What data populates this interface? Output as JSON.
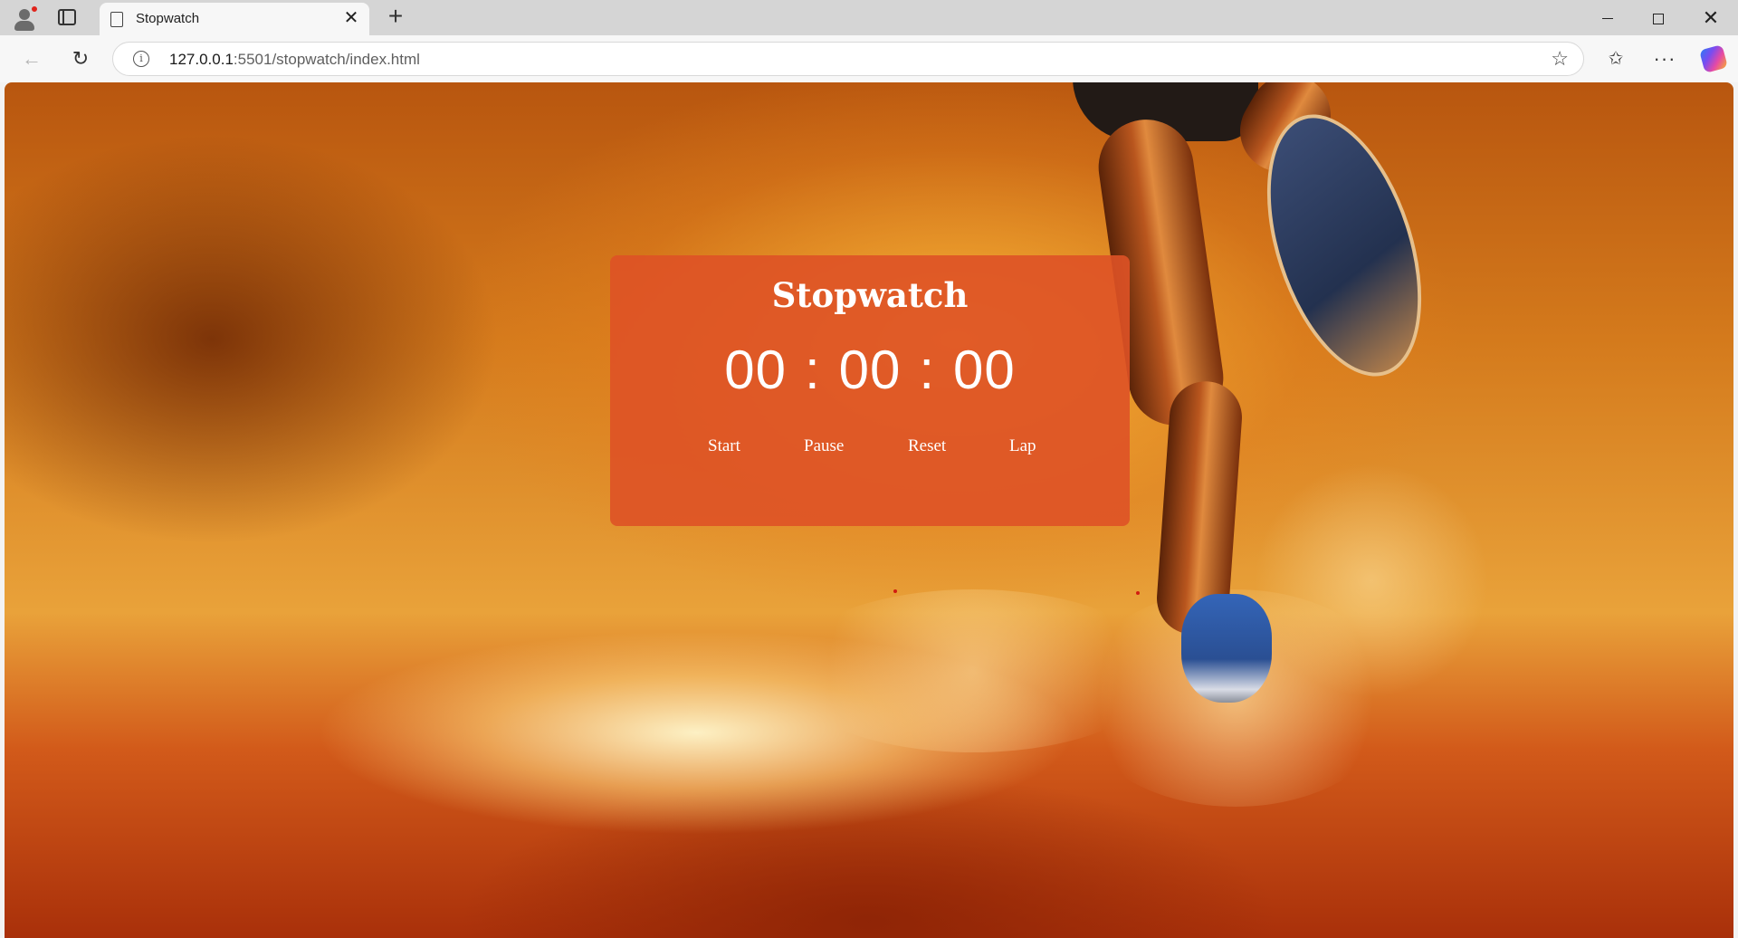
{
  "browser": {
    "tab_title": "Stopwatch",
    "url_host": "127.0.0.1",
    "url_rest": ":5501/stopwatch/index.html"
  },
  "icons": {
    "profile": "profile-icon",
    "tabs": "tab-actions-icon",
    "page": "page-icon",
    "close": "close-icon",
    "new_tab": "plus-icon",
    "back": "back-arrow-icon",
    "reload": "reload-icon",
    "info": "info-icon",
    "star": "star-icon",
    "favorites": "favorites-icon",
    "more": "more-icon",
    "copilot": "copilot-icon"
  },
  "stopwatch": {
    "title": "Stopwatch",
    "hours": "00",
    "minutes": "00",
    "seconds": "00",
    "separator": ":",
    "buttons": {
      "start": "Start",
      "pause": "Pause",
      "reset": "Reset",
      "lap": "Lap"
    }
  },
  "colors": {
    "card": "#de5226",
    "text": "#ffffff"
  }
}
